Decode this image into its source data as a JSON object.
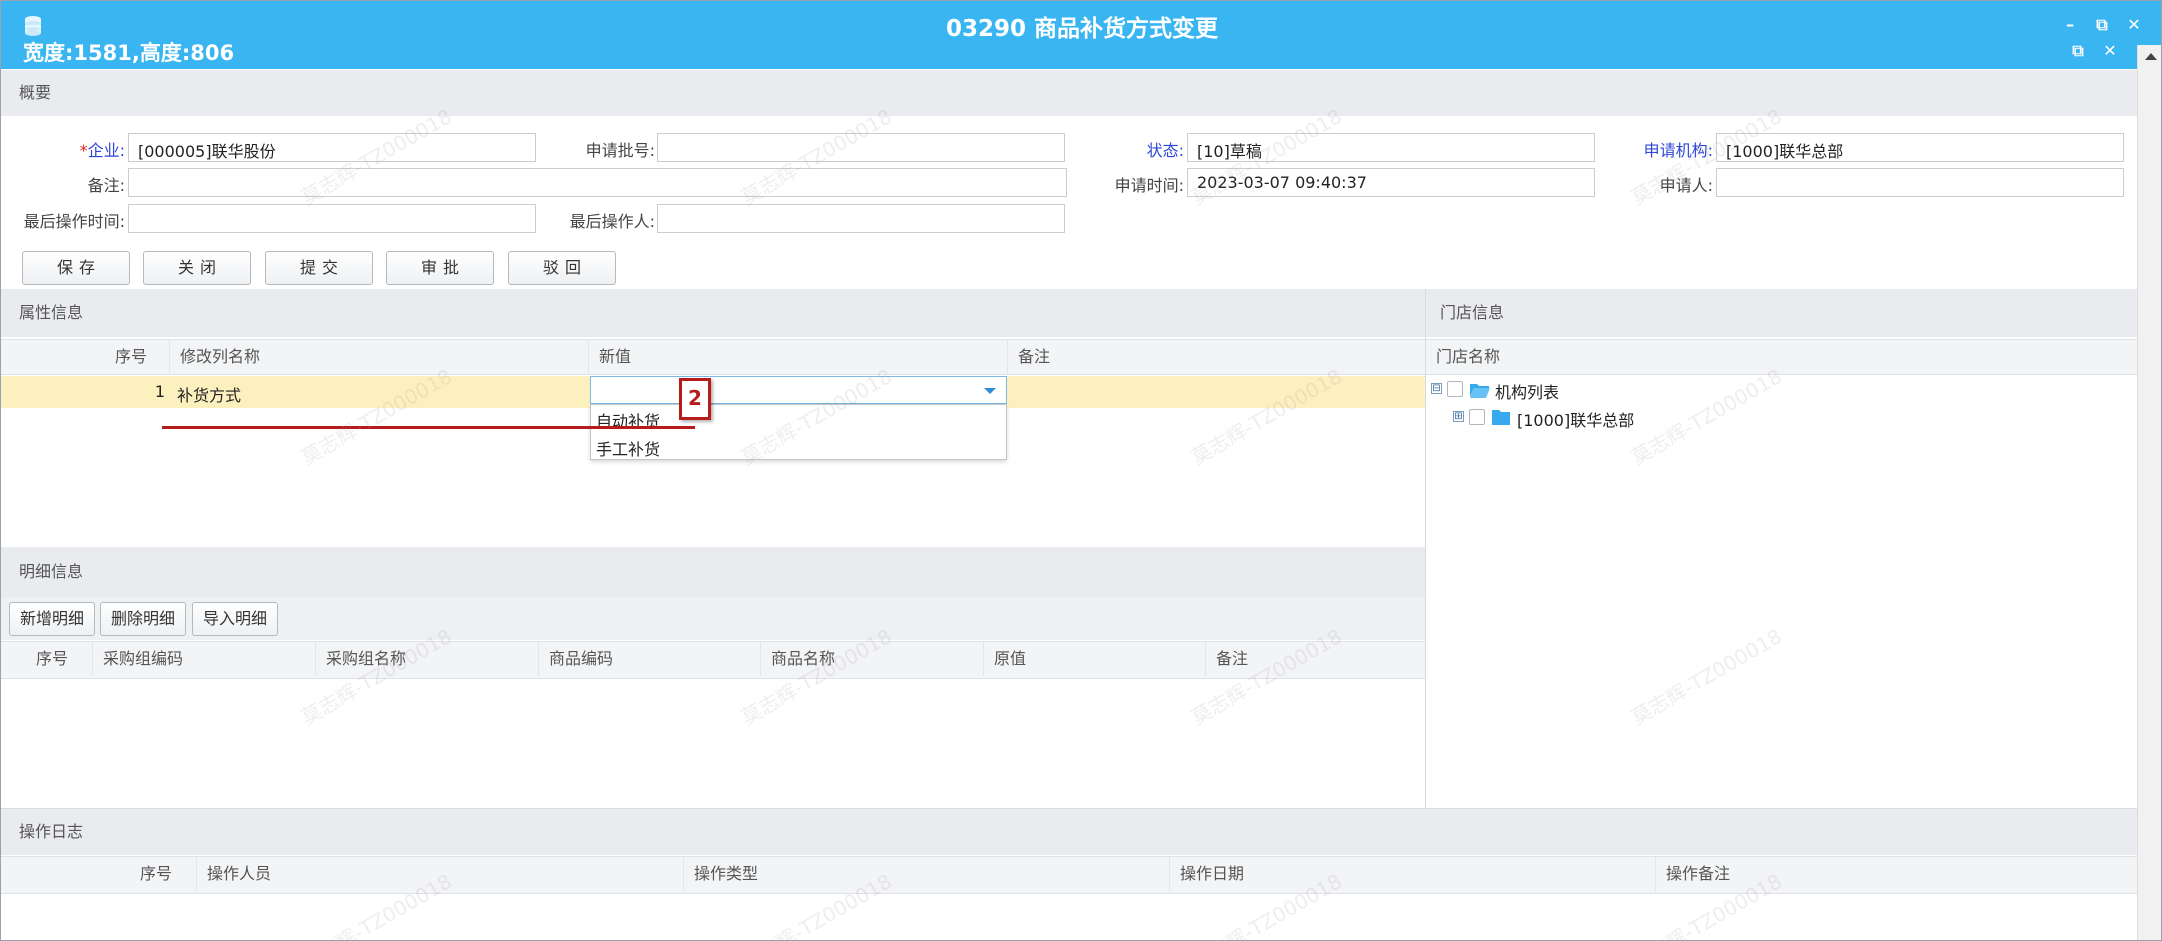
{
  "window": {
    "title": "03290 商品补货方式变更",
    "size_readout": "宽度:1581,高度:806",
    "controls": {
      "minimize": "–",
      "restore": "⧉",
      "close": "✕",
      "inner_restore": "⧉",
      "inner_close": "✕"
    }
  },
  "summary": {
    "header": "概要",
    "required_mark": "*",
    "fields": {
      "company_label": "企业:",
      "company_value": "[000005]联华股份",
      "batch_label": "申请批号:",
      "batch_value": "",
      "status_label": "状态:",
      "status_value": "[10]草稿",
      "org_label": "申请机构:",
      "org_value": "[1000]联华总部",
      "remark_label": "备注:",
      "remark_value": "",
      "apply_time_label": "申请时间:",
      "apply_time_value": "2023-03-07 09:40:37",
      "applicant_label": "申请人:",
      "applicant_value": "",
      "last_op_time_label": "最后操作时间:",
      "last_op_time_value": "",
      "last_operator_label": "最后操作人:",
      "last_operator_value": ""
    },
    "buttons": {
      "save": "保存",
      "close": "关闭",
      "submit": "提交",
      "approve": "审批",
      "reject": "驳回"
    }
  },
  "attributes": {
    "header": "属性信息",
    "columns": [
      "序号",
      "修改列名称",
      "新值",
      "备注"
    ],
    "rows": [
      {
        "seq": "1",
        "name": "补货方式",
        "new_value": "",
        "remark": ""
      }
    ],
    "dropdown_options": [
      "自动补货",
      "手工补货"
    ],
    "step_marker": "2"
  },
  "stores": {
    "header": "门店信息",
    "column": "门店名称",
    "tree": {
      "root": {
        "label": "机构列表",
        "expander": "⊟"
      },
      "child": {
        "label": "[1000]联华总部",
        "expander": "⊞"
      }
    }
  },
  "details": {
    "header": "明细信息",
    "buttons": {
      "add": "新增明细",
      "delete": "删除明细",
      "import": "导入明细"
    },
    "columns": [
      "序号",
      "采购组编码",
      "采购组名称",
      "商品编码",
      "商品名称",
      "原值",
      "备注"
    ]
  },
  "log": {
    "header": "操作日志",
    "columns": [
      "序号",
      "操作人员",
      "操作类型",
      "操作日期",
      "操作备注"
    ]
  },
  "watermark": "莫志辉-TZ000018",
  "colors": {
    "titlebar": "#39b6f2",
    "selected_row": "#fdf0bf",
    "marker": "#b61c1c",
    "label_blue": "#2f47d8"
  }
}
